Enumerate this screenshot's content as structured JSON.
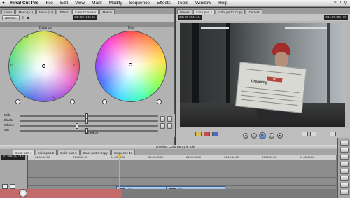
{
  "menubar": {
    "apple": "",
    "items": [
      "Final Cut Pro",
      "File",
      "Edit",
      "View",
      "Mark",
      "Modify",
      "Sequence",
      "Effects",
      "Tools",
      "Window",
      "Help"
    ]
  },
  "left_panel": {
    "tabs": [
      "Video",
      "Mono (a1)",
      "Mono (a2)",
      "Filters",
      "Color Corrector",
      "Motion"
    ],
    "numeric_button": "Numeric",
    "timecode": "01:00:04:15",
    "wheel1_label": "Balance",
    "wheel2_label": "Hue",
    "wheel1_marks": [
      "R",
      "Mg",
      "B",
      "Cy",
      "G",
      "Yl"
    ],
    "sliders": [
      "Mids",
      "Blacks",
      "Whites",
      "Sat"
    ],
    "limit_effect": "Limit Effect"
  },
  "viewer": {
    "tabs": [
      "Viewer",
      "Color part 1",
      "color part 3 Copy",
      "Canvas"
    ],
    "timecode_left": "01:00:04:15",
    "timecode_right": "01:00:04:15",
    "paper_headline": "Creaming",
    "paper_banner": "Uc"
  },
  "timeline": {
    "title": "Timeline: Color part 1 in rule",
    "tabs": [
      "Color part 1",
      "color part 2",
      "Color part 3",
      "Color part 3 Copy",
      "Sequence 16"
    ],
    "timecode": "01:00:04:15",
    "ruler_ticks": [
      "01:00:00:00",
      "01:00:02:00",
      "01:00:04:00",
      "01:00:06:00",
      "01:00:08:00",
      "01:00:10:00",
      "01:00:12:00",
      "01:00:14:00"
    ],
    "clips": [
      "H2C",
      "H2S"
    ]
  },
  "colors": {
    "accent_red": "#c36a6a",
    "clip_blue": "#7aa3d2",
    "playhead": "#e0b020"
  }
}
